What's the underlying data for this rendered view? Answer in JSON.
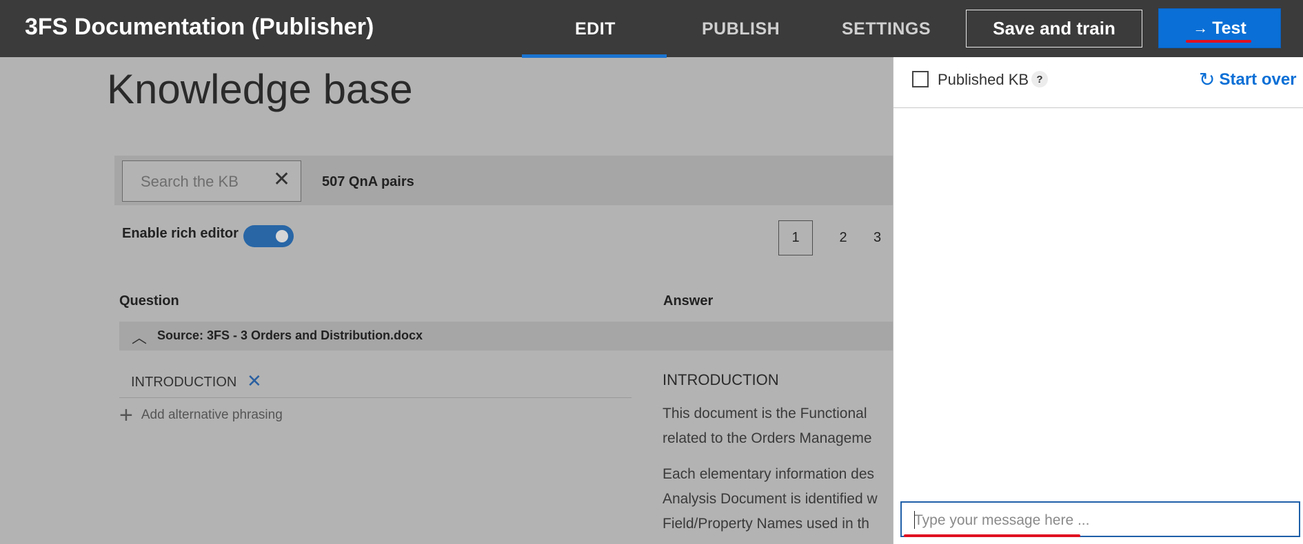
{
  "app": {
    "title": "3FS Documentation (Publisher)"
  },
  "nav": {
    "tabs": [
      {
        "label": "EDIT",
        "active": true
      },
      {
        "label": "PUBLISH",
        "active": false
      },
      {
        "label": "SETTINGS",
        "active": false
      }
    ],
    "save_label": "Save and train",
    "test_label": "Test",
    "test_icon": "arrow-right-icon"
  },
  "kb": {
    "title": "Knowledge base",
    "search": {
      "placeholder": "Search the KB",
      "value": ""
    },
    "qna_count": "507 QnA pairs",
    "rich_editor": {
      "label": "Enable rich editor",
      "enabled": true
    },
    "pagination": {
      "pages": [
        "1",
        "2",
        "3"
      ],
      "current": "1"
    },
    "columns": {
      "question": "Question",
      "answer": "Answer"
    },
    "source": {
      "label": "Source: 3FS - 3 Orders and Distribution.docx",
      "expanded": true
    },
    "qna": {
      "question": "INTRODUCTION",
      "add_alt": "Add alternative phrasing",
      "answer_title": "INTRODUCTION",
      "answer_lines": [
        "This document is the Functional",
        "related to the Orders Manageme",
        "Each elementary information des",
        "Analysis Document is identified w",
        "Field/Property Names used in th"
      ]
    }
  },
  "test_panel": {
    "published_kb": {
      "label": "Published KB",
      "checked": false,
      "help": "?"
    },
    "start_over": "Start over",
    "message_input": {
      "placeholder": "Type your message here ...",
      "value": ""
    }
  },
  "colors": {
    "topbar": "#3b3b3b",
    "accent": "#0a6fd6",
    "highlight": "#e01020",
    "toggle": "#2866a6"
  }
}
